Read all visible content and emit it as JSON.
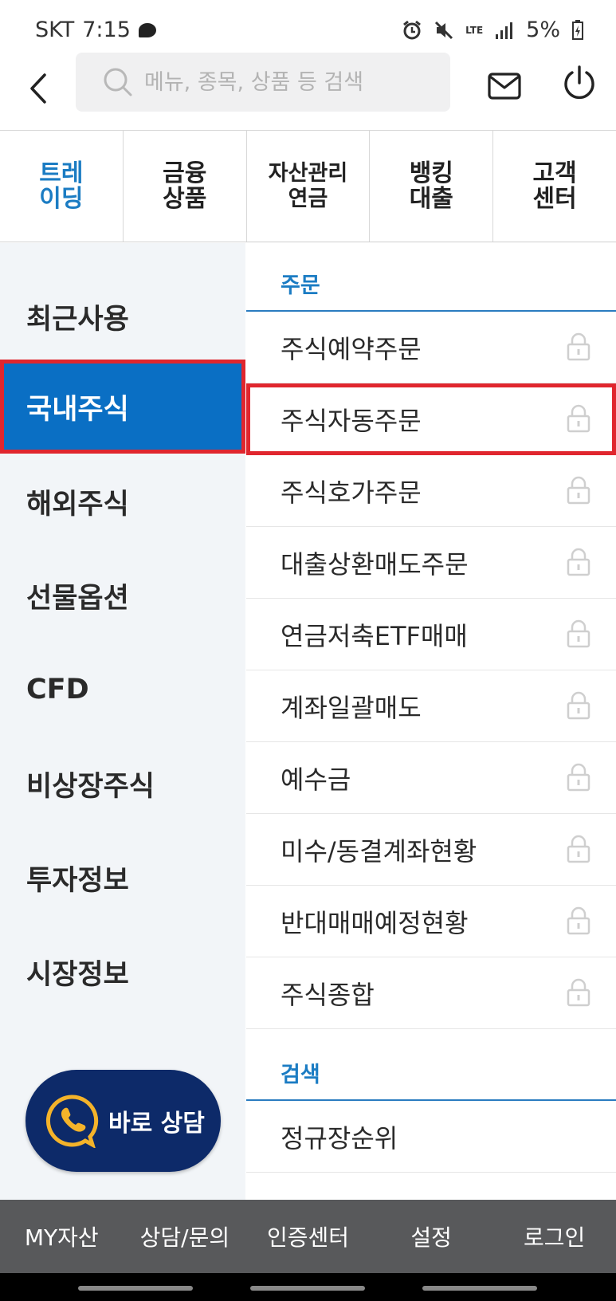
{
  "status_bar": {
    "carrier": "SKT",
    "time": "7:15",
    "network": "LTE",
    "battery": "5%"
  },
  "search": {
    "placeholder": "메뉴, 종목, 상품 등 검색"
  },
  "category_tabs": [
    {
      "label": "트레\n이딩",
      "active": true
    },
    {
      "label": "금융\n상품",
      "active": false
    },
    {
      "label": "자산관리\n연금",
      "active": false
    },
    {
      "label": "뱅킹\n대출",
      "active": false
    },
    {
      "label": "고객\n센터",
      "active": false
    }
  ],
  "left_menu": [
    {
      "label": "최근사용"
    },
    {
      "label": "국내주식",
      "active": true
    },
    {
      "label": "해외주식"
    },
    {
      "label": "선물옵션"
    },
    {
      "label": "CFD"
    },
    {
      "label": "비상장주식"
    },
    {
      "label": "투자정보"
    },
    {
      "label": "시장정보"
    }
  ],
  "consult_button": {
    "label": "바로 상담"
  },
  "sections": [
    {
      "title": "주문",
      "items": [
        {
          "label": "주식예약주문"
        },
        {
          "label": "주식자동주문",
          "highlighted": true
        },
        {
          "label": "주식호가주문"
        },
        {
          "label": "대출상환매도주문"
        },
        {
          "label": "연금저축ETF매매"
        },
        {
          "label": "계좌일괄매도"
        },
        {
          "label": "예수금"
        },
        {
          "label": "미수/동결계좌현황"
        },
        {
          "label": "반대매매예정현황"
        },
        {
          "label": "주식종합"
        }
      ]
    },
    {
      "title": "검색",
      "items": [
        {
          "label": "정규장순위"
        }
      ]
    }
  ],
  "bottom_nav": [
    {
      "label": "MY자산"
    },
    {
      "label": "상담/문의"
    },
    {
      "label": "인증센터"
    },
    {
      "label": "설정"
    },
    {
      "label": "로그인"
    }
  ],
  "colors": {
    "accent": "#1b7cc3",
    "active_bg": "#0a6fc4",
    "highlight_border": "#e0262e",
    "consult_bg": "#0d2a69",
    "bottom_nav_bg": "#58595b"
  }
}
